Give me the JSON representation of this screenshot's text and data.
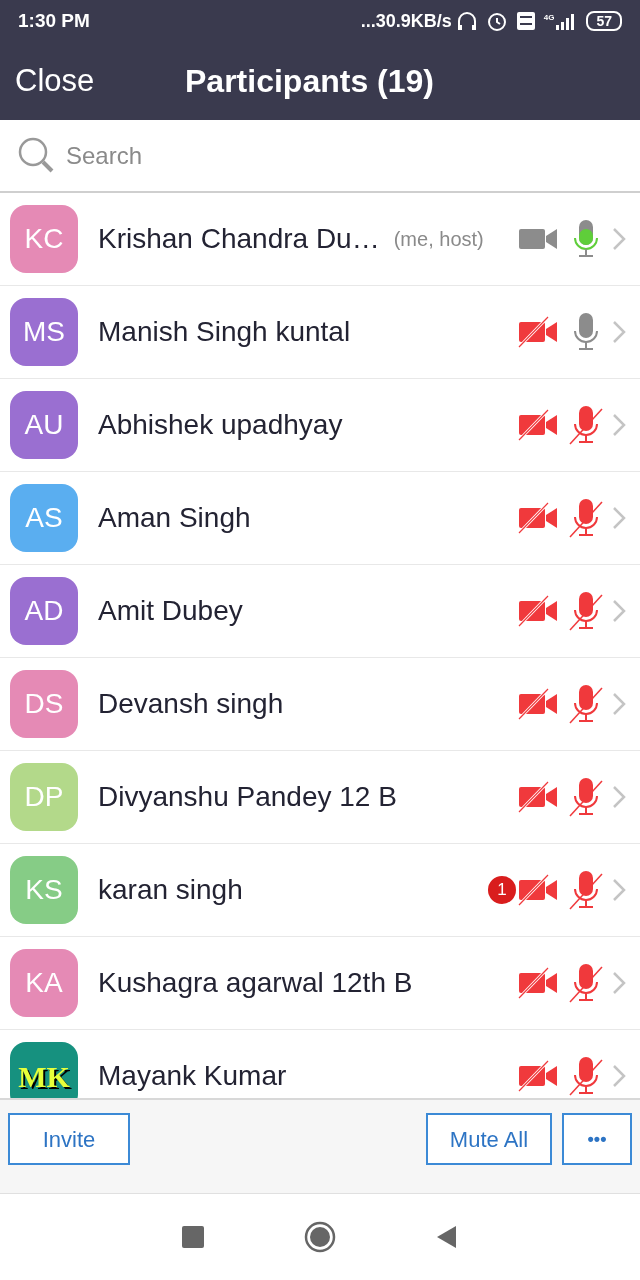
{
  "status_bar": {
    "time": "1:30 PM",
    "speed": "...30.9KB/s",
    "network": "4G",
    "battery": "57"
  },
  "header": {
    "close": "Close",
    "title": "Participants (19)"
  },
  "search": {
    "placeholder": "Search"
  },
  "participants": [
    {
      "initials": "KC",
      "color": "#e58ab5",
      "kind": "plain",
      "name": "Krishan Chandra Du…",
      "tag": "(me, host)",
      "video_on": true,
      "muted": false,
      "speaking": true
    },
    {
      "initials": "MS",
      "color": "#9a6fd1",
      "kind": "plain",
      "name": "Manish Singh kuntal",
      "video_on": false,
      "muted": false,
      "speaking": false
    },
    {
      "initials": "AU",
      "color": "#9a6fd1",
      "kind": "plain",
      "name": "Abhishek upadhyay",
      "video_on": false,
      "muted": true,
      "speaking": false
    },
    {
      "initials": "AS",
      "color": "#5aaef0",
      "kind": "plain",
      "name": "Aman Singh",
      "video_on": false,
      "muted": true,
      "speaking": false
    },
    {
      "initials": "AD",
      "color": "#9a6fd1",
      "kind": "plain",
      "name": "Amit Dubey",
      "video_on": false,
      "muted": true,
      "speaking": false
    },
    {
      "initials": "DS",
      "color": "#e58ab5",
      "kind": "plain",
      "name": "Devansh singh",
      "video_on": false,
      "muted": true,
      "speaking": false
    },
    {
      "initials": "DP",
      "color": "#b3d98a",
      "kind": "plain",
      "name": "Divyanshu Pandey 12 B",
      "video_on": false,
      "muted": true,
      "speaking": false
    },
    {
      "initials": "KS",
      "color": "#86cc86",
      "kind": "plain",
      "name": "karan singh",
      "badge": "1",
      "video_on": false,
      "muted": true,
      "speaking": false
    },
    {
      "initials": "KA",
      "color": "#e58ab5",
      "kind": "plain",
      "name": "Kushagra agarwal 12th B",
      "video_on": false,
      "muted": true,
      "speaking": false
    },
    {
      "initials": "MK",
      "color": "#16917f",
      "kind": "stylized",
      "name": "Mayank Kumar",
      "video_on": false,
      "muted": true,
      "speaking": false
    }
  ],
  "footer": {
    "invite": "Invite",
    "mute_all": "Mute All",
    "more": "•••"
  }
}
